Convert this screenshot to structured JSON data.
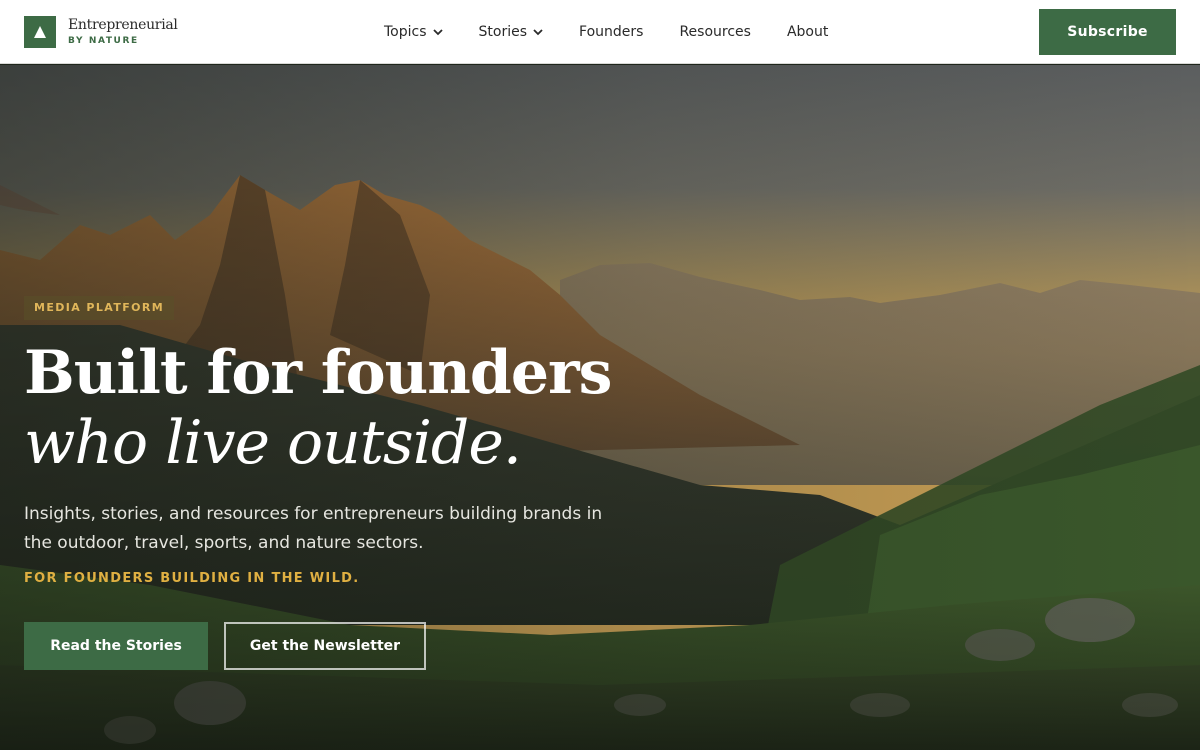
{
  "header": {
    "logo": {
      "name": "Entrepreneurial",
      "subtitle": "BY NATURE",
      "icon": "mountain-triangle-icon"
    },
    "nav": [
      {
        "label": "Topics",
        "has_dropdown": true
      },
      {
        "label": "Stories",
        "has_dropdown": true
      },
      {
        "label": "Founders",
        "has_dropdown": false
      },
      {
        "label": "Resources",
        "has_dropdown": false
      },
      {
        "label": "About",
        "has_dropdown": false
      }
    ],
    "subscribe_label": "Subscribe"
  },
  "hero": {
    "eyebrow": "MEDIA PLATFORM",
    "headline_line1": "Built for founders",
    "headline_line2": "who live outside.",
    "description": "Insights, stories, and resources for entrepreneurs building brands in the outdoor, travel, sports, and nature sectors.",
    "tagline": "FOR FOUNDERS BUILDING IN THE WILD.",
    "primary_cta": "Read the Stories",
    "secondary_cta": "Get the Newsletter"
  },
  "colors": {
    "brand_green": "#3d6b45",
    "accent_gold": "#e0b042",
    "header_bg": "#ffffff"
  }
}
